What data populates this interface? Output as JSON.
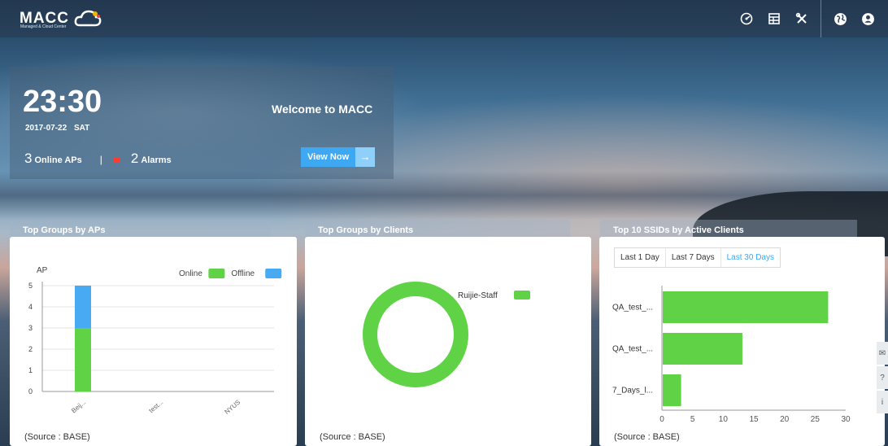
{
  "header": {
    "logo_text": "MACC",
    "logo_subtitle": "Managed & Cloud Center",
    "icons": [
      "dashboard-icon",
      "report-icon",
      "tools-icon",
      "globe-icon",
      "user-icon"
    ]
  },
  "welcome": {
    "time": "23:30",
    "date": "2017-07-22",
    "weekday": "SAT",
    "online_aps_count": "3",
    "online_aps_label": "Online APs",
    "separator": "|",
    "alarms_count": "2",
    "alarms_label": "Alarms",
    "message": "Welcome to MACC",
    "view_button": "View Now",
    "view_arrow": "→"
  },
  "colors": {
    "online": "#5fd345",
    "offline": "#48aaf2",
    "accent": "#3ea8f2",
    "alarm": "#ff3b2f"
  },
  "cards": {
    "aps": {
      "title": "Top Groups by APs",
      "source": "(Source : BASE)"
    },
    "clients": {
      "title": "Top Groups by Clients",
      "source": "(Source : BASE)"
    },
    "ssids": {
      "title": "Top 10 SSIDs by Active Clients",
      "source": "(Source : BASE)",
      "range_tabs": [
        "Last 1 Day",
        "Last 7 Days",
        "Last 30 Days"
      ],
      "active_tab": "Last 30 Days"
    }
  },
  "chart_data": [
    {
      "type": "bar",
      "stacked": true,
      "ylabel": "AP",
      "categories": [
        "Beij...",
        "test...",
        "NYUS"
      ],
      "series": [
        {
          "name": "Online",
          "values": [
            3,
            0,
            0
          ]
        },
        {
          "name": "Offline",
          "values": [
            2,
            0,
            0
          ]
        }
      ],
      "ylim": [
        0,
        5
      ],
      "yticks": [
        0,
        1,
        2,
        3,
        4,
        5
      ],
      "grid": true,
      "legend": "top-right"
    },
    {
      "type": "pie",
      "donut": true,
      "series": [
        {
          "name": "Ruijie-Staff",
          "values": [
            100
          ]
        }
      ],
      "legend": "right"
    },
    {
      "type": "bar",
      "orientation": "horizontal",
      "categories": [
        "QA_test_...",
        "QA_test_...",
        "7_Days_l..."
      ],
      "values": [
        27,
        13,
        3
      ],
      "xlim": [
        0,
        30
      ],
      "xticks": [
        0,
        5,
        10,
        15,
        20,
        25,
        30
      ]
    }
  ],
  "side_tools": [
    "message-icon",
    "help-icon",
    "info-icon"
  ],
  "side_glyphs": [
    "✉",
    "?",
    "i"
  ]
}
